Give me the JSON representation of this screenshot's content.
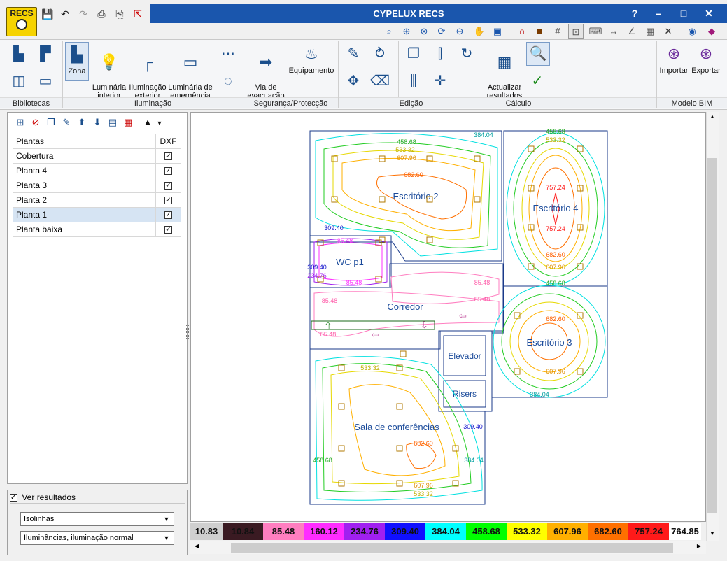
{
  "window": {
    "title": "CYPELUX RECS",
    "help": "?",
    "minimize": "–",
    "maximize": "□",
    "close": "✕"
  },
  "logo": {
    "text": "RECS"
  },
  "quick_access": [
    "save-icon",
    "undo-icon",
    "redo-icon",
    "print-icon",
    "print-preview-icon",
    "export-icon"
  ],
  "ribbon": {
    "groups": [
      {
        "label": "Bibliotecas"
      },
      {
        "label": "Iluminação"
      },
      {
        "label": "Segurança/Protecção"
      },
      {
        "label": "Edição"
      },
      {
        "label": "Cálculo"
      },
      {
        "label": "Modelo BIM"
      }
    ],
    "buttons": {
      "zona": "Zona",
      "luminaria_interior": "Luminária\ninterior",
      "iluminacao_exterior": "Iluminação\nexterior",
      "luminaria_emergencia": "Luminária de\nemergência",
      "via_evacuacao": "Via de\nevacuação",
      "equipamento": "Equipamento",
      "actualizar": "Actualizar\nresultados",
      "importar": "Importar",
      "exportar": "Exportar"
    }
  },
  "plantas": {
    "header": {
      "name": "Plantas",
      "dxf": "DXF"
    },
    "rows": [
      {
        "name": "Cobertura",
        "checked": true
      },
      {
        "name": "Planta 4",
        "checked": true
      },
      {
        "name": "Planta 3",
        "checked": true
      },
      {
        "name": "Planta 2",
        "checked": true
      },
      {
        "name": "Planta 1",
        "checked": true,
        "selected": true
      },
      {
        "name": "Planta baixa",
        "checked": true
      }
    ]
  },
  "results": {
    "label": "Ver resultados",
    "checked": true,
    "mode": "Isolinhas",
    "quantity": "Iluminâncias, iluminação normal"
  },
  "rooms": {
    "escritorio2": "Escritório 2",
    "escritorio4": "Escritório 4",
    "wc": "WC p1",
    "corredor": "Corredor",
    "escritorio3": "Escritório 3",
    "elevador": "Elevador",
    "risers": "Risers",
    "sala": "Sala de conferências"
  },
  "legend": [
    {
      "value": "10.83",
      "color": "#cfcfcf",
      "text_color": "#111"
    },
    {
      "value": "10.84",
      "color": "#3a1a22",
      "text_color": "#111"
    },
    {
      "value": "85.48",
      "color": "#ff7ec0",
      "text_color": "#111"
    },
    {
      "value": "160.12",
      "color": "#ff2cff",
      "text_color": "#111"
    },
    {
      "value": "234.76",
      "color": "#a020f0",
      "text_color": "#111"
    },
    {
      "value": "309.40",
      "color": "#1010ff",
      "text_color": "#111"
    },
    {
      "value": "384.04",
      "color": "#00ffff",
      "text_color": "#111"
    },
    {
      "value": "458.68",
      "color": "#00ff00",
      "text_color": "#111"
    },
    {
      "value": "533.32",
      "color": "#ffff00",
      "text_color": "#111"
    },
    {
      "value": "607.96",
      "color": "#ffb000",
      "text_color": "#111"
    },
    {
      "value": "682.60",
      "color": "#ff7000",
      "text_color": "#111"
    },
    {
      "value": "757.24",
      "color": "#ff1a1a",
      "text_color": "#111"
    },
    {
      "value": "764.85",
      "color": "#ffffff",
      "text_color": "#111"
    }
  ],
  "isolines": {
    "e2": [
      "458.68",
      "533.32",
      "607.96",
      "682.60",
      "384.04",
      "309.40"
    ],
    "e4": [
      "458.68",
      "533.32",
      "757.24",
      "757.24",
      "682.60",
      "607.96",
      "458.68"
    ],
    "e3": [
      "682.60",
      "607.96",
      "384.04"
    ],
    "sala": [
      "533.32",
      "682.60",
      "607.96",
      "533.32",
      "309.40",
      "384.04",
      "458.68"
    ],
    "wc": [
      "85.48",
      "309.40",
      "234.76",
      "85.48"
    ],
    "corr": [
      "85.48",
      "85.48",
      "85.48",
      "85.48"
    ]
  }
}
